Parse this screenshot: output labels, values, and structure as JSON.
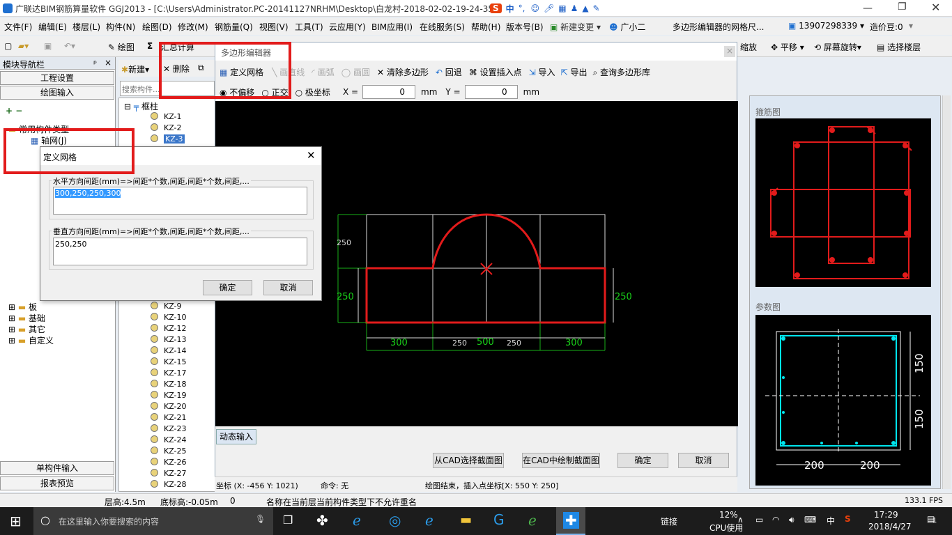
{
  "titlebar": {
    "title": "广联达BIM钢筋算量软件 GGJ2013 - [C:\\Users\\Administrator.PC-20141127NRHM\\Desktop\\白龙村-2018-02-02-19-24-35"
  },
  "ime": {
    "label": "中"
  },
  "menu": [
    "文件(F)",
    "编辑(E)",
    "楼层(L)",
    "构件(N)",
    "绘图(D)",
    "修改(M)",
    "钢筋量(Q)",
    "视图(V)",
    "工具(T)",
    "云应用(Y)",
    "BIM应用(I)",
    "在线服务(S)",
    "帮助(H)",
    "版本号(B)",
    "新建变更",
    "广小二",
    "多边形编辑器的网格尺..."
  ],
  "account": {
    "phone": "13907298339",
    "cost_bean": "造价豆:0"
  },
  "toolbar": {
    "draw": "绘图",
    "sum": "汇总计算",
    "zoom": "缩放",
    "pan": "平移",
    "rotate": "屏幕旋转",
    "select_floor": "选择楼层"
  },
  "leftnav": {
    "title": "模块导航栏",
    "engineering": "工程设置",
    "draw_input": "绘图输入",
    "common_types": "常用构件类型",
    "axis": "轴网(J)",
    "tree": [
      "板",
      "基础",
      "其它",
      "自定义"
    ],
    "single_input": "单构件输入",
    "report": "报表预览"
  },
  "comp_toolbar": {
    "new": "新建",
    "delete": "删除",
    "search_placeholder": "搜索构件..."
  },
  "component_tree": {
    "root": "框柱",
    "items": [
      "KZ-1",
      "KZ-2",
      "KZ-3",
      "KZ-9",
      "KZ-10",
      "KZ-12",
      "KZ-13",
      "KZ-14",
      "KZ-15",
      "KZ-17",
      "KZ-18",
      "KZ-19",
      "KZ-20",
      "KZ-21",
      "KZ-23",
      "KZ-24",
      "KZ-25",
      "KZ-26",
      "KZ-27",
      "KZ-28"
    ],
    "selected": "KZ-3"
  },
  "polygon_editor": {
    "title": "多边形编辑器",
    "tools": {
      "define_grid": "定义网格",
      "draw_line": "画直线",
      "draw_arc": "画弧",
      "draw_circle": "画圆",
      "clear": "清除多边形",
      "undo": "回退",
      "set_insert": "设置插入点",
      "import": "导入",
      "export": "导出",
      "query_lib": "查询多边形库"
    },
    "mode": {
      "no_offset": "不偏移",
      "orthogonal": "正交",
      "polar": "极坐标",
      "x_label": "X =",
      "x_value": "0",
      "y_label": "Y =",
      "y_value": "0",
      "unit": "mm"
    },
    "dims": {
      "left_top": "250",
      "left_bottom": "250",
      "right": "250",
      "bottom_left": "300",
      "bottom_mid_a": "250",
      "bottom_total": "500",
      "bottom_mid_b": "250",
      "bottom_right": "300"
    },
    "dynamic_input": "动态输入",
    "buttons": {
      "cad_select": "从CAD选择截面图",
      "cad_draw": "在CAD中绘制截面图",
      "ok": "确定",
      "cancel": "取消"
    },
    "status": {
      "coords": "坐标 (X: -456 Y: 1021)",
      "command": "命令: 无",
      "message": "绘图结束，插入点坐标[X: 550 Y: 250]"
    }
  },
  "right_panels": {
    "stirrup_title": "箍筋图",
    "param_title": "参数图",
    "dim_h": "200",
    "dim_v": "150"
  },
  "define_grid_dialog": {
    "title": "定义网格",
    "h_label": "水平方向间距(mm)=>间距*个数,间距,间距*个数,间距,...",
    "h_value": "300,250,250,300",
    "v_label": "垂直方向间距(mm)=>间距*个数,间距,间距*个数,间距,...",
    "v_value": "250,250",
    "ok": "确定",
    "cancel": "取消"
  },
  "statusbar": {
    "floor_height": "层高:4.5m",
    "bottom_height": "底标高:-0.05m",
    "zero": "0",
    "message": "名称在当前层当前构件类型下不允许重名",
    "fps": "133.1 FPS"
  },
  "taskbar": {
    "search_placeholder": "在这里输入你要搜索的内容",
    "link": "链接",
    "cpu_pct": "12%",
    "cpu_label": "CPU使用",
    "lang": "中",
    "time": "17:29",
    "date": "2018/4/27",
    "notifications": "1"
  },
  "colors": {
    "accent_red": "#e21b1b",
    "taskbar": "#1c1c1c",
    "canvas": "#000000",
    "dim_green": "#19d119",
    "cyan": "#00e5ee"
  }
}
